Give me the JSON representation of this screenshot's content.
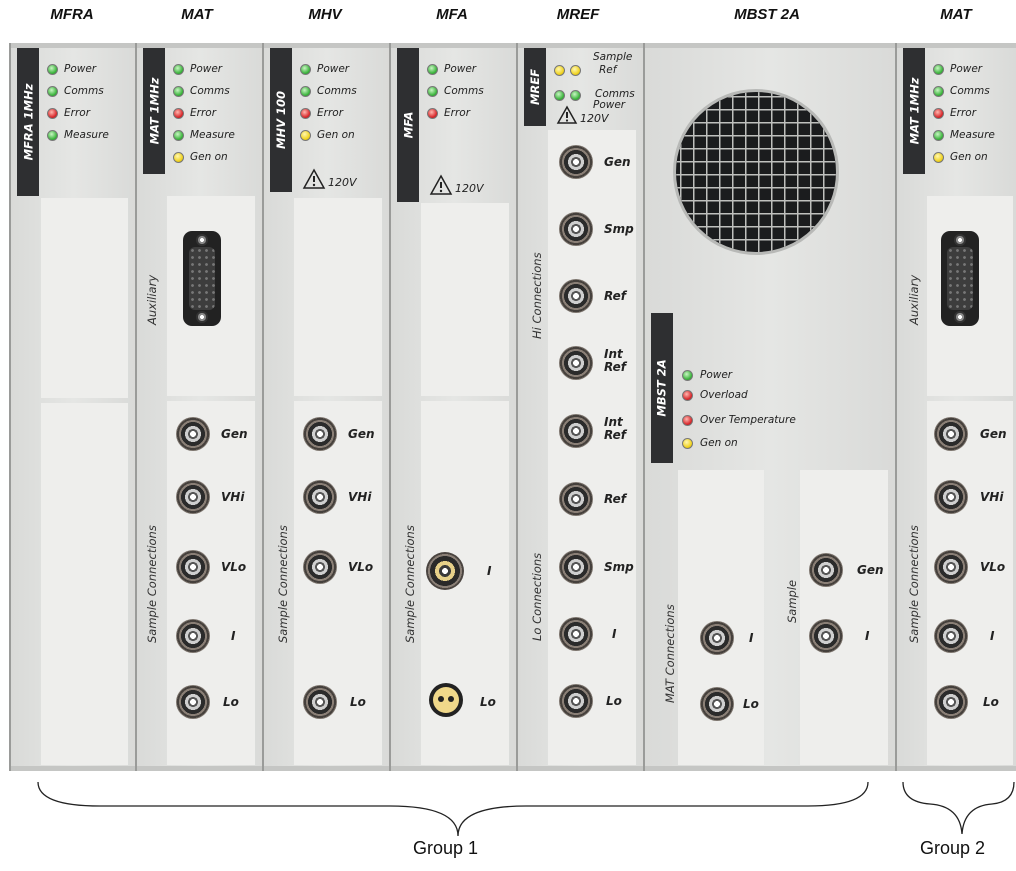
{
  "module_titles": {
    "mfra": "MFRA",
    "mat": "MAT",
    "mhv": "MHV",
    "mfa": "MFA",
    "mref": "MREF",
    "mbst": "MBST 2A",
    "mat2": "MAT"
  },
  "mfra": {
    "tag": "MFRA 1MHz",
    "indicators": [
      "Power",
      "Comms",
      "Error",
      "Measure"
    ]
  },
  "mat": {
    "tag": "MAT 1MHz",
    "indicators": [
      "Power",
      "Comms",
      "Error",
      "Measure",
      "Gen on"
    ],
    "aux_label": "Auxiliary",
    "conn_label": "Sample Connections",
    "ports": [
      "Gen",
      "VHi",
      "VLo",
      "I",
      "Lo"
    ]
  },
  "mhv": {
    "tag": "MHV 100",
    "indicators": [
      "Power",
      "Comms",
      "Error",
      "Gen on"
    ],
    "warning": "120V",
    "conn_label": "Sample Connections",
    "ports": [
      "Gen",
      "VHi",
      "VLo",
      "Lo"
    ]
  },
  "mfa": {
    "tag": "MFA",
    "indicators": [
      "Power",
      "Comms",
      "Error"
    ],
    "warning": "120V",
    "conn_label": "Sample Connections",
    "ports": [
      "I",
      "Lo"
    ]
  },
  "mref": {
    "tag": "MREF",
    "indicators": [
      "Sample",
      "Ref",
      "Comms",
      "Power"
    ],
    "warning": "120V",
    "hi_label": "Hi Connections",
    "lo_label": "Lo Connections",
    "hi_ports": [
      "Gen",
      "Smp",
      "Ref",
      "Int Ref"
    ],
    "lo_ports": [
      "Int Ref",
      "Ref",
      "Smp",
      "I",
      "Lo"
    ]
  },
  "mbst": {
    "tag": "MBST 2A",
    "indicators": [
      "Power",
      "Overload",
      "Over Temperature",
      "Gen on"
    ],
    "mat_conn_label": "MAT Connections",
    "sample_label": "Sample",
    "mat_ports": [
      "I",
      "Lo"
    ],
    "sample_ports": [
      "Gen",
      "I"
    ]
  },
  "mat2": {
    "tag": "MAT 1MHz",
    "indicators": [
      "Power",
      "Comms",
      "Error",
      "Measure",
      "Gen on"
    ],
    "aux_label": "Auxiliary",
    "conn_label": "Sample Connections",
    "ports": [
      "Gen",
      "VHi",
      "VLo",
      "I",
      "Lo"
    ]
  },
  "groups": [
    "Group 1",
    "Group 2"
  ],
  "colors": {
    "led_green": "#39b33a",
    "led_red": "#d8262a",
    "led_yellow": "#f0d21c",
    "tag_bg": "#2e2f31"
  }
}
